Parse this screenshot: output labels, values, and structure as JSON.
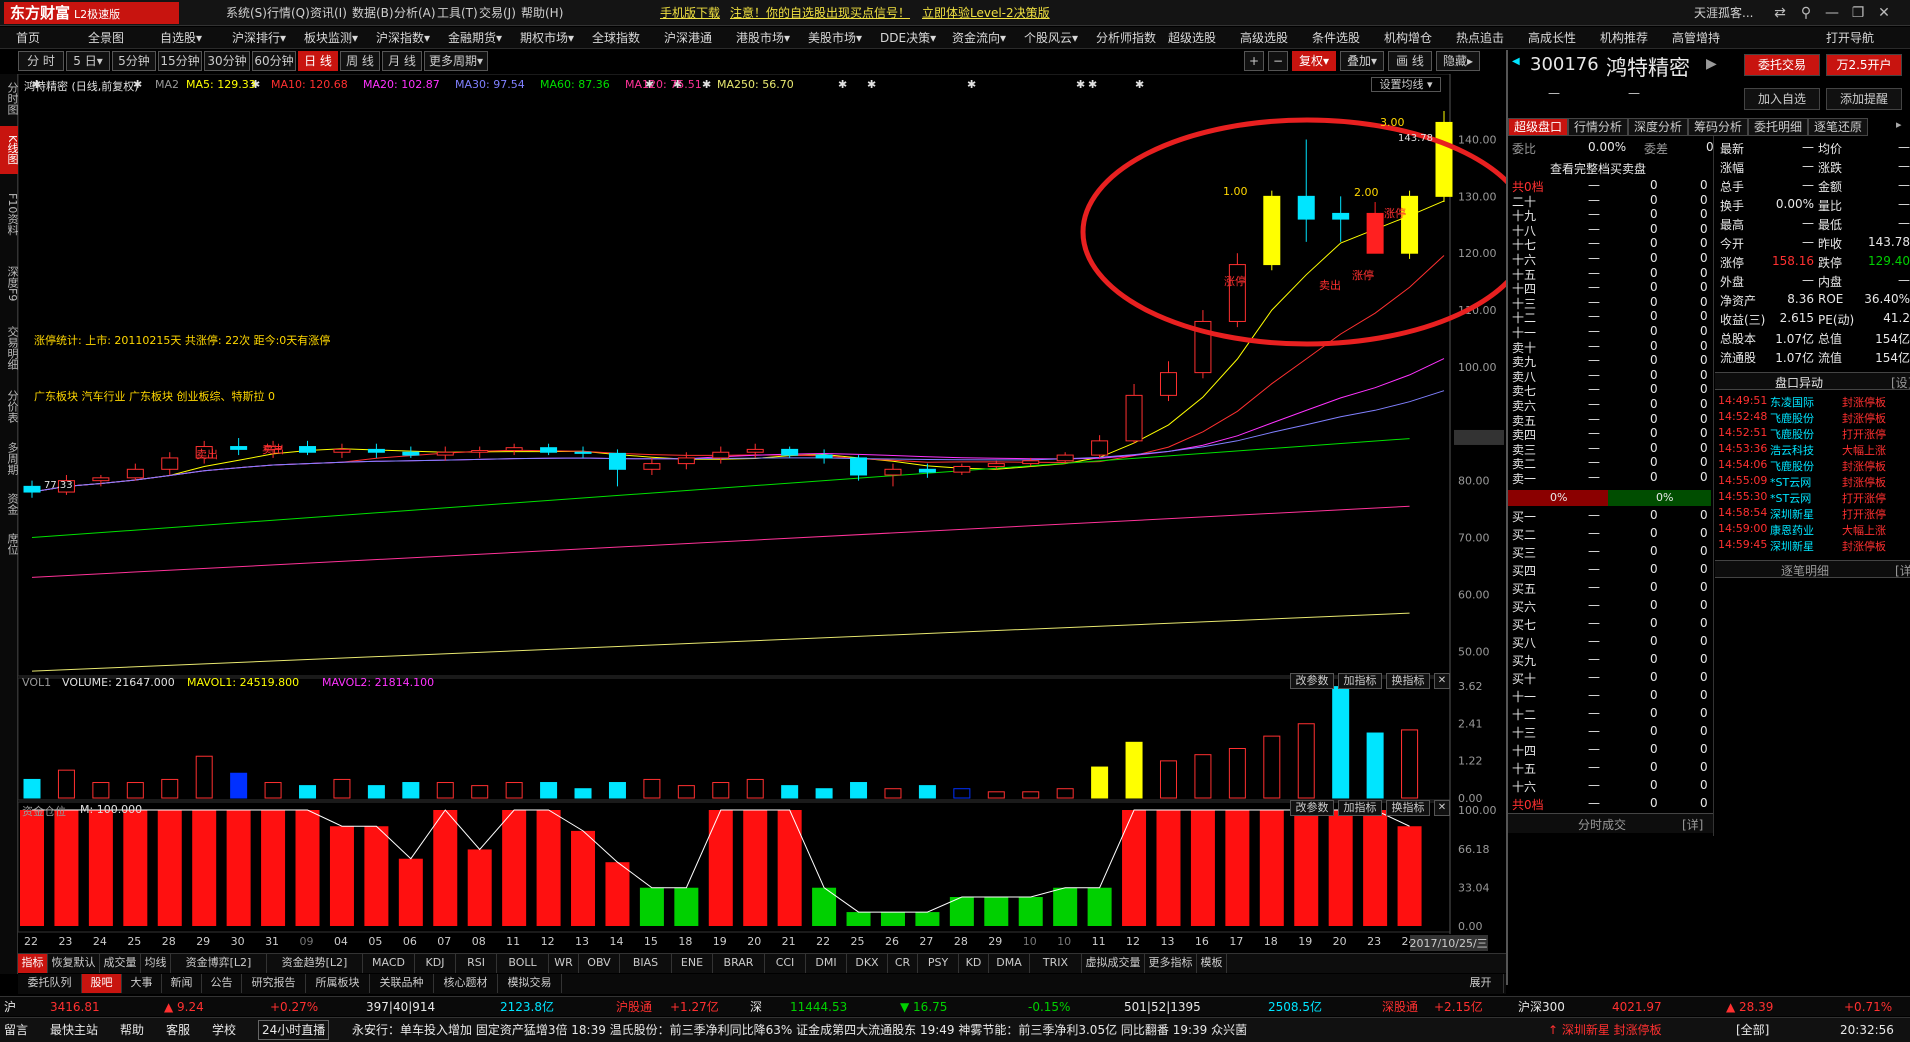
{
  "app": {
    "logo": "东方财富",
    "logo_sub": "L2极速版",
    "menus": [
      "系统(S)",
      "行情(Q)",
      "资讯(I)",
      "数据(B)",
      "分析(A)",
      "工具(T)",
      "交易(J)",
      "帮助(H)"
    ],
    "links": [
      "手机版下载",
      "注意！你的自选股出现买点信号！",
      "立即体验Level-2决策版"
    ],
    "user": "天涯孤客..."
  },
  "nav": [
    "首页",
    "全景图",
    "自选股▾",
    "沪深排行▾",
    "板块监测▾",
    "沪深指数▾",
    "金融期货▾",
    "期权市场▾",
    "全球指数",
    "沪深港通",
    "港股市场▾",
    "美股市场▾",
    "DDE决策▾",
    "资金流向▾",
    "个股风云▾",
    "分析师指数",
    "超级选股",
    "高级选股",
    "条件选股",
    "机构增仓",
    "热点追击",
    "高成长性",
    "机构推荐",
    "高管增持",
    "打开导航"
  ],
  "periods": [
    "分 时",
    "5 日▾",
    "5分钟",
    "15分钟",
    "30分钟",
    "60分钟",
    "日 线",
    "周 线",
    "月 线",
    "更多周期▾"
  ],
  "active_period": "日 线",
  "chart_tools": [
    "+",
    "−",
    "复权▾",
    "叠加▾",
    "画 线",
    "隐藏▸"
  ],
  "left_tabs": [
    "分时图",
    "K线图",
    "F10资料",
    "深度F9",
    "交易明细",
    "分价表",
    "多周期",
    "资金",
    "席位"
  ],
  "stock_title": "鸿特精密 (日线,前复权)",
  "ma_prefix": "MA2",
  "ma_values": [
    {
      "label": "MA5: 129.33",
      "color": "#ffff00"
    },
    {
      "label": "MA10: 120.68",
      "color": "#ff3030"
    },
    {
      "label": "MA20: 102.87",
      "color": "#ff33ff"
    },
    {
      "label": "MA30: 97.54",
      "color": "#8080ff"
    },
    {
      "label": "MA60: 87.36",
      "color": "#00e000"
    },
    {
      "label": "MA120: 75.51",
      "color": "#ff3399"
    },
    {
      "label": "MA250: 56.70",
      "color": "#e8e870"
    }
  ],
  "set_ma_button": "设置均线 ▾",
  "limit_stats": "涨停统计:   上市: 20110215天    共涨停: 22次    距今:0天有涨停",
  "sector_tags": "广东板块 汽车行业 广东板块 创业板综、特斯拉 0",
  "annotations": {
    "sell1": "卖出",
    "sell2": "卖出",
    "sell3": "卖出",
    "limit_up": "涨停",
    "val_100": "1.00",
    "val_200": "2.00",
    "val_300": "3.00",
    "high_price": "143.78",
    "low_price": "77.33"
  },
  "price_axis": [
    "140.00",
    "130.00",
    "120.00",
    "110.00",
    "100.00",
    "87.51",
    "80.00",
    "70.00",
    "60.00",
    "50.00"
  ],
  "vol_legend": {
    "name": "VOL1",
    "volume": "VOLUME: 21647.000",
    "mavol1": "MAVOL1: 24519.800",
    "mavol2": "MAVOL2: 21814.100"
  },
  "vol_axis": [
    "3.62",
    "2.41",
    "1.22",
    "0.00"
  ],
  "panel_buttons": [
    "改参数",
    "加指标",
    "换指标"
  ],
  "fund_legend": {
    "name": "资金仓位",
    "m": "M: 100.000"
  },
  "fund_axis": [
    "100.00",
    "66.18",
    "33.04",
    "0.00"
  ],
  "date_axis": [
    "22",
    "23",
    "24",
    "25",
    "28",
    "29",
    "30",
    "31",
    "09",
    "04",
    "05",
    "06",
    "07",
    "08",
    "11",
    "12",
    "13",
    "14",
    "15",
    "18",
    "19",
    "20",
    "21",
    "22",
    "25",
    "26",
    "27",
    "28",
    "29",
    "10",
    "10",
    "11",
    "12",
    "13",
    "16",
    "17",
    "18",
    "19",
    "20",
    "23",
    "24",
    "2017/10/25/三"
  ],
  "indicator_tabs": [
    "指标",
    "恢复默认",
    "成交量",
    "均线",
    "资金博弈[L2]",
    "资金趋势[L2]",
    "MACD",
    "KDJ",
    "RSI",
    "BOLL",
    "WR",
    "OBV",
    "BIAS",
    "ENE",
    "BRAR",
    "CCI",
    "DMI",
    "DKX",
    "CR",
    "PSY",
    "KD",
    "DMA",
    "TRIX",
    "虚拟成交量",
    "更多指标",
    "模板"
  ],
  "module_tabs": [
    "委托队列",
    "股吧",
    "大事",
    "新闻",
    "公告",
    "研究报告",
    "所属板块",
    "关联品种",
    "核心题材",
    "模拟交易"
  ],
  "module_expand": "展开",
  "quote": {
    "code": "300176",
    "name": "鸿特精密",
    "sub_dash": "—",
    "buttons": [
      "委托交易",
      "万2.5开户",
      "加入自选",
      "添加提醒"
    ],
    "tabs": [
      "超级盘口",
      "行情分析",
      "深度分析",
      "筹码分析",
      "委托明细",
      "逐笔还原"
    ],
    "webi_label": "委比",
    "webi_val": "0.00%",
    "weicha_label": "委差",
    "weicha_val": "0",
    "full_book": "查看完整档买卖盘",
    "sell_levels": [
      "共0档",
      "二十",
      "十九",
      "十八",
      "十七",
      "十六",
      "十五",
      "十四",
      "十三",
      "十二",
      "十一",
      "卖十",
      "卖九",
      "卖八",
      "卖七",
      "卖六",
      "卖五",
      "卖四",
      "卖三",
      "卖二",
      "卖一"
    ],
    "buy_levels": [
      "买一",
      "买二",
      "买三",
      "买四",
      "买五",
      "买六",
      "买七",
      "买八",
      "买九",
      "买十",
      "十一",
      "十二",
      "十三",
      "十四",
      "十五",
      "十六",
      "共0档"
    ],
    "split_left": "0%",
    "split_right": "0%",
    "time_trades": "分时成交",
    "detail_tag": "[详]",
    "stats": [
      {
        "l": "最新",
        "v": "—",
        "l2": "均价",
        "v2": "—"
      },
      {
        "l": "涨幅",
        "v": "—",
        "l2": "涨跌",
        "v2": "—"
      },
      {
        "l": "总手",
        "v": "—",
        "l2": "金额",
        "v2": "—"
      },
      {
        "l": "换手",
        "v": "0.00%",
        "l2": "量比",
        "v2": "—"
      },
      {
        "l": "最高",
        "v": "—",
        "l2": "最低",
        "v2": "—"
      },
      {
        "l": "今开",
        "v": "—",
        "l2": "昨收",
        "v2": "143.78"
      },
      {
        "l": "涨停",
        "v": "158.16",
        "l2": "跌停",
        "v2": "129.40"
      },
      {
        "l": "外盘",
        "v": "—",
        "l2": "内盘",
        "v2": "—"
      },
      {
        "l": "净资产",
        "v": "8.36",
        "l2": "ROE",
        "v2": "36.40%"
      },
      {
        "l": "收益(三)",
        "v": "2.615",
        "l2": "PE(动)",
        "v2": "41.2"
      },
      {
        "l": "总股本",
        "v": "1.07亿",
        "l2": "总值",
        "v2": "154亿"
      },
      {
        "l": "流通股",
        "v": "1.07亿",
        "l2": "流值",
        "v2": "154亿"
      }
    ],
    "abnormal_title": "盘口异动",
    "abnormal_set": "[设]",
    "abnormal": [
      {
        "t": "14:49:51",
        "n": "东凌国际",
        "e": "封涨停板"
      },
      {
        "t": "14:52:48",
        "n": "飞鹿股份",
        "e": "封涨停板"
      },
      {
        "t": "14:52:51",
        "n": "飞鹿股份",
        "e": "打开涨停"
      },
      {
        "t": "14:53:36",
        "n": "浩云科技",
        "e": "大幅上涨"
      },
      {
        "t": "14:54:06",
        "n": "飞鹿股份",
        "e": "封涨停板"
      },
      {
        "t": "14:55:09",
        "n": "*ST云网",
        "e": "封涨停板"
      },
      {
        "t": "14:55:30",
        "n": "*ST云网",
        "e": "打开涨停"
      },
      {
        "t": "14:58:54",
        "n": "深圳新星",
        "e": "打开涨停"
      },
      {
        "t": "14:59:00",
        "n": "康恩药业",
        "e": "大幅上涨"
      },
      {
        "t": "14:59:45",
        "n": "深圳新星",
        "e": "封涨停板"
      }
    ],
    "tick_title": "逐笔明细",
    "tick_detail": "[详]"
  },
  "status": {
    "sh_label": "沪",
    "sh_index": "3416.81",
    "sh_change": "▲ 9.24",
    "sh_pct": "+0.27%",
    "sh_counts": "397|40|914",
    "sh_amount": "2123.8亿",
    "hgt_label": "沪股通",
    "hgt_val": "+1.27亿",
    "sz_label": "深",
    "sz_index": "11444.53",
    "sz_change": "▼ 16.75",
    "sz_pct": "-0.15%",
    "sz_counts": "501|52|1395",
    "sz_amount": "2508.5亿",
    "sgt_label": "深股通",
    "sgt_val": "+2.15亿",
    "hs300_label": "沪深300",
    "hs300": "4021.97",
    "hs300_change": "▲ 28.39",
    "hs300_pct": "+0.71%"
  },
  "news": {
    "items": [
      "留言",
      "最快主站",
      "帮助",
      "客服",
      "学校",
      "24小时直播"
    ],
    "ticker": "永安行：单车投入增加 固定资产猛增3倍   18:39  温氏股份：前三季净利同比降63%  证金成第四大流通股东   19:49  神雾节能：前三季净利3.05亿 同比翻番   19:39  众兴菌",
    "alert": "↑ 深圳新星 封涨停板",
    "all": "[全部]",
    "time": "20:32:56"
  }
}
